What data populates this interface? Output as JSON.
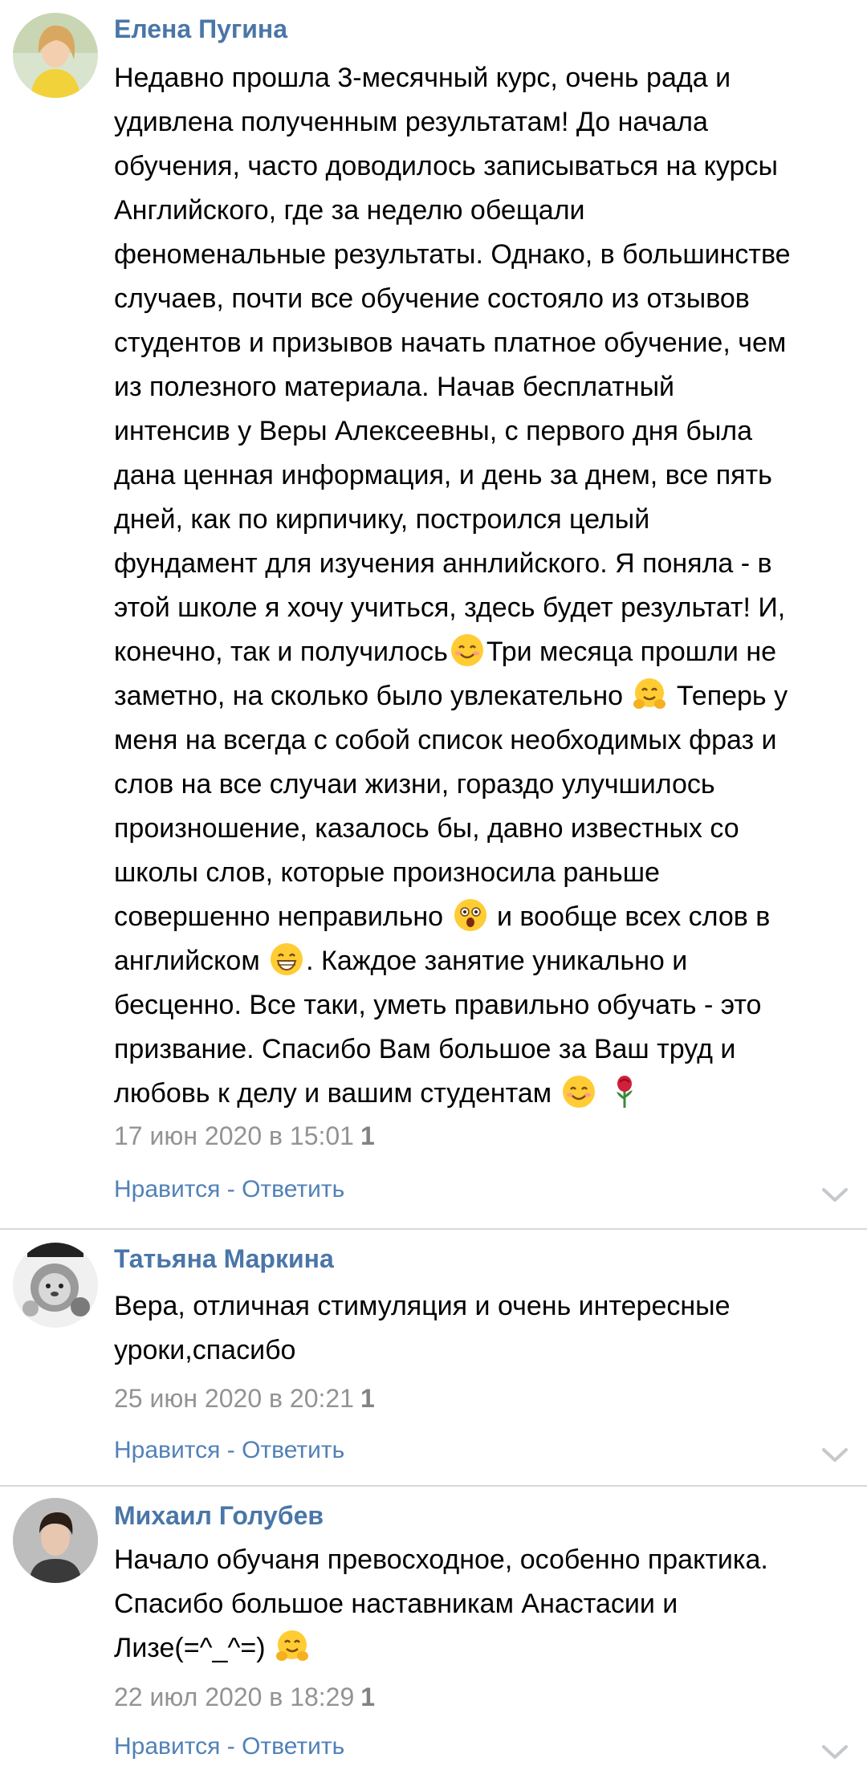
{
  "comments": [
    {
      "author": "Елена Пугина",
      "avatar_icon": "user-avatar-photo",
      "text_lines": [
        "Недавно прошла 3-месячный курс, очень рада и",
        "удивлена полученным результатам! До начала",
        "обучения, часто доводилось записываться на курсы",
        "Английского, где за неделю обещали",
        "феноменальные результаты. Однако, в большинстве",
        "случаев, почти все обучение состояло из отзывов",
        "студентов и призывов начать платное обучение, чем",
        "из полезного материала. Начав бесплатный",
        "интенсив у Веры Алексеевны, с первого дня была",
        "дана ценная информация, и день за днем, все пять",
        "дней, как по кирпичику, построился целый",
        "фундамент для изучения аннлийского. Я поняла - в",
        "этой школе я хочу учиться, здесь будет результат! И,",
        [
          "конечно, так и получилось",
          "smiling-face-emoji",
          "Три месяца прошли не"
        ],
        [
          "заметно, на сколько было увлекательно ",
          "hugging-face-emoji",
          " Теперь у"
        ],
        "меня на всегда с собой список необходимых фраз и",
        "слов на все случаи жизни, гораздо улучшилось",
        "произношение, казалось бы, давно известных со",
        "школы слов, которые произносила раньше",
        [
          "совершенно неправильно ",
          "astonished-face-emoji",
          " и вообще всех слов в"
        ],
        [
          "английском ",
          "grinning-face-emoji",
          ". Каждое занятие уникально и"
        ],
        "бесценно. Все таки, уметь правильно обучать - это",
        "призвание. Спасибо Вам большое за Ваш труд и",
        [
          "любовь к делу и вашим студентам ",
          "smiling-face-emoji",
          " ",
          "rose-emoji"
        ]
      ],
      "date": "17 июн 2020 в 15:01",
      "likes": "1",
      "like_label": "Нравится",
      "separator": " - ",
      "reply_label": "Ответить"
    },
    {
      "author": "Татьяна Маркина",
      "avatar_icon": "cartoon-lion-avatar",
      "text_lines": [
        "Вера, отличная стимуляция и очень интересные",
        "уроки,спасибо"
      ],
      "date": "25 июн 2020 в 20:21",
      "likes": "1",
      "like_label": "Нравится",
      "separator": " - ",
      "reply_label": "Ответить"
    },
    {
      "author": "Михаил Голубев",
      "avatar_icon": "user-avatar-photo",
      "text_lines": [
        "Начало обучаня превосходное, особенно практика.",
        "Спасибо большое наставникам Анастасии и",
        [
          "Лизе(=^_^=) ",
          "hugging-face-emoji"
        ]
      ],
      "date": "22 июл 2020 в 18:29",
      "likes": "1",
      "like_label": "Нравится",
      "separator": " - ",
      "reply_label": "Ответить"
    }
  ],
  "colors": {
    "author": "#4a76a8",
    "action": "#5181b8",
    "meta": "#939393",
    "divider": "#d7d8db"
  }
}
